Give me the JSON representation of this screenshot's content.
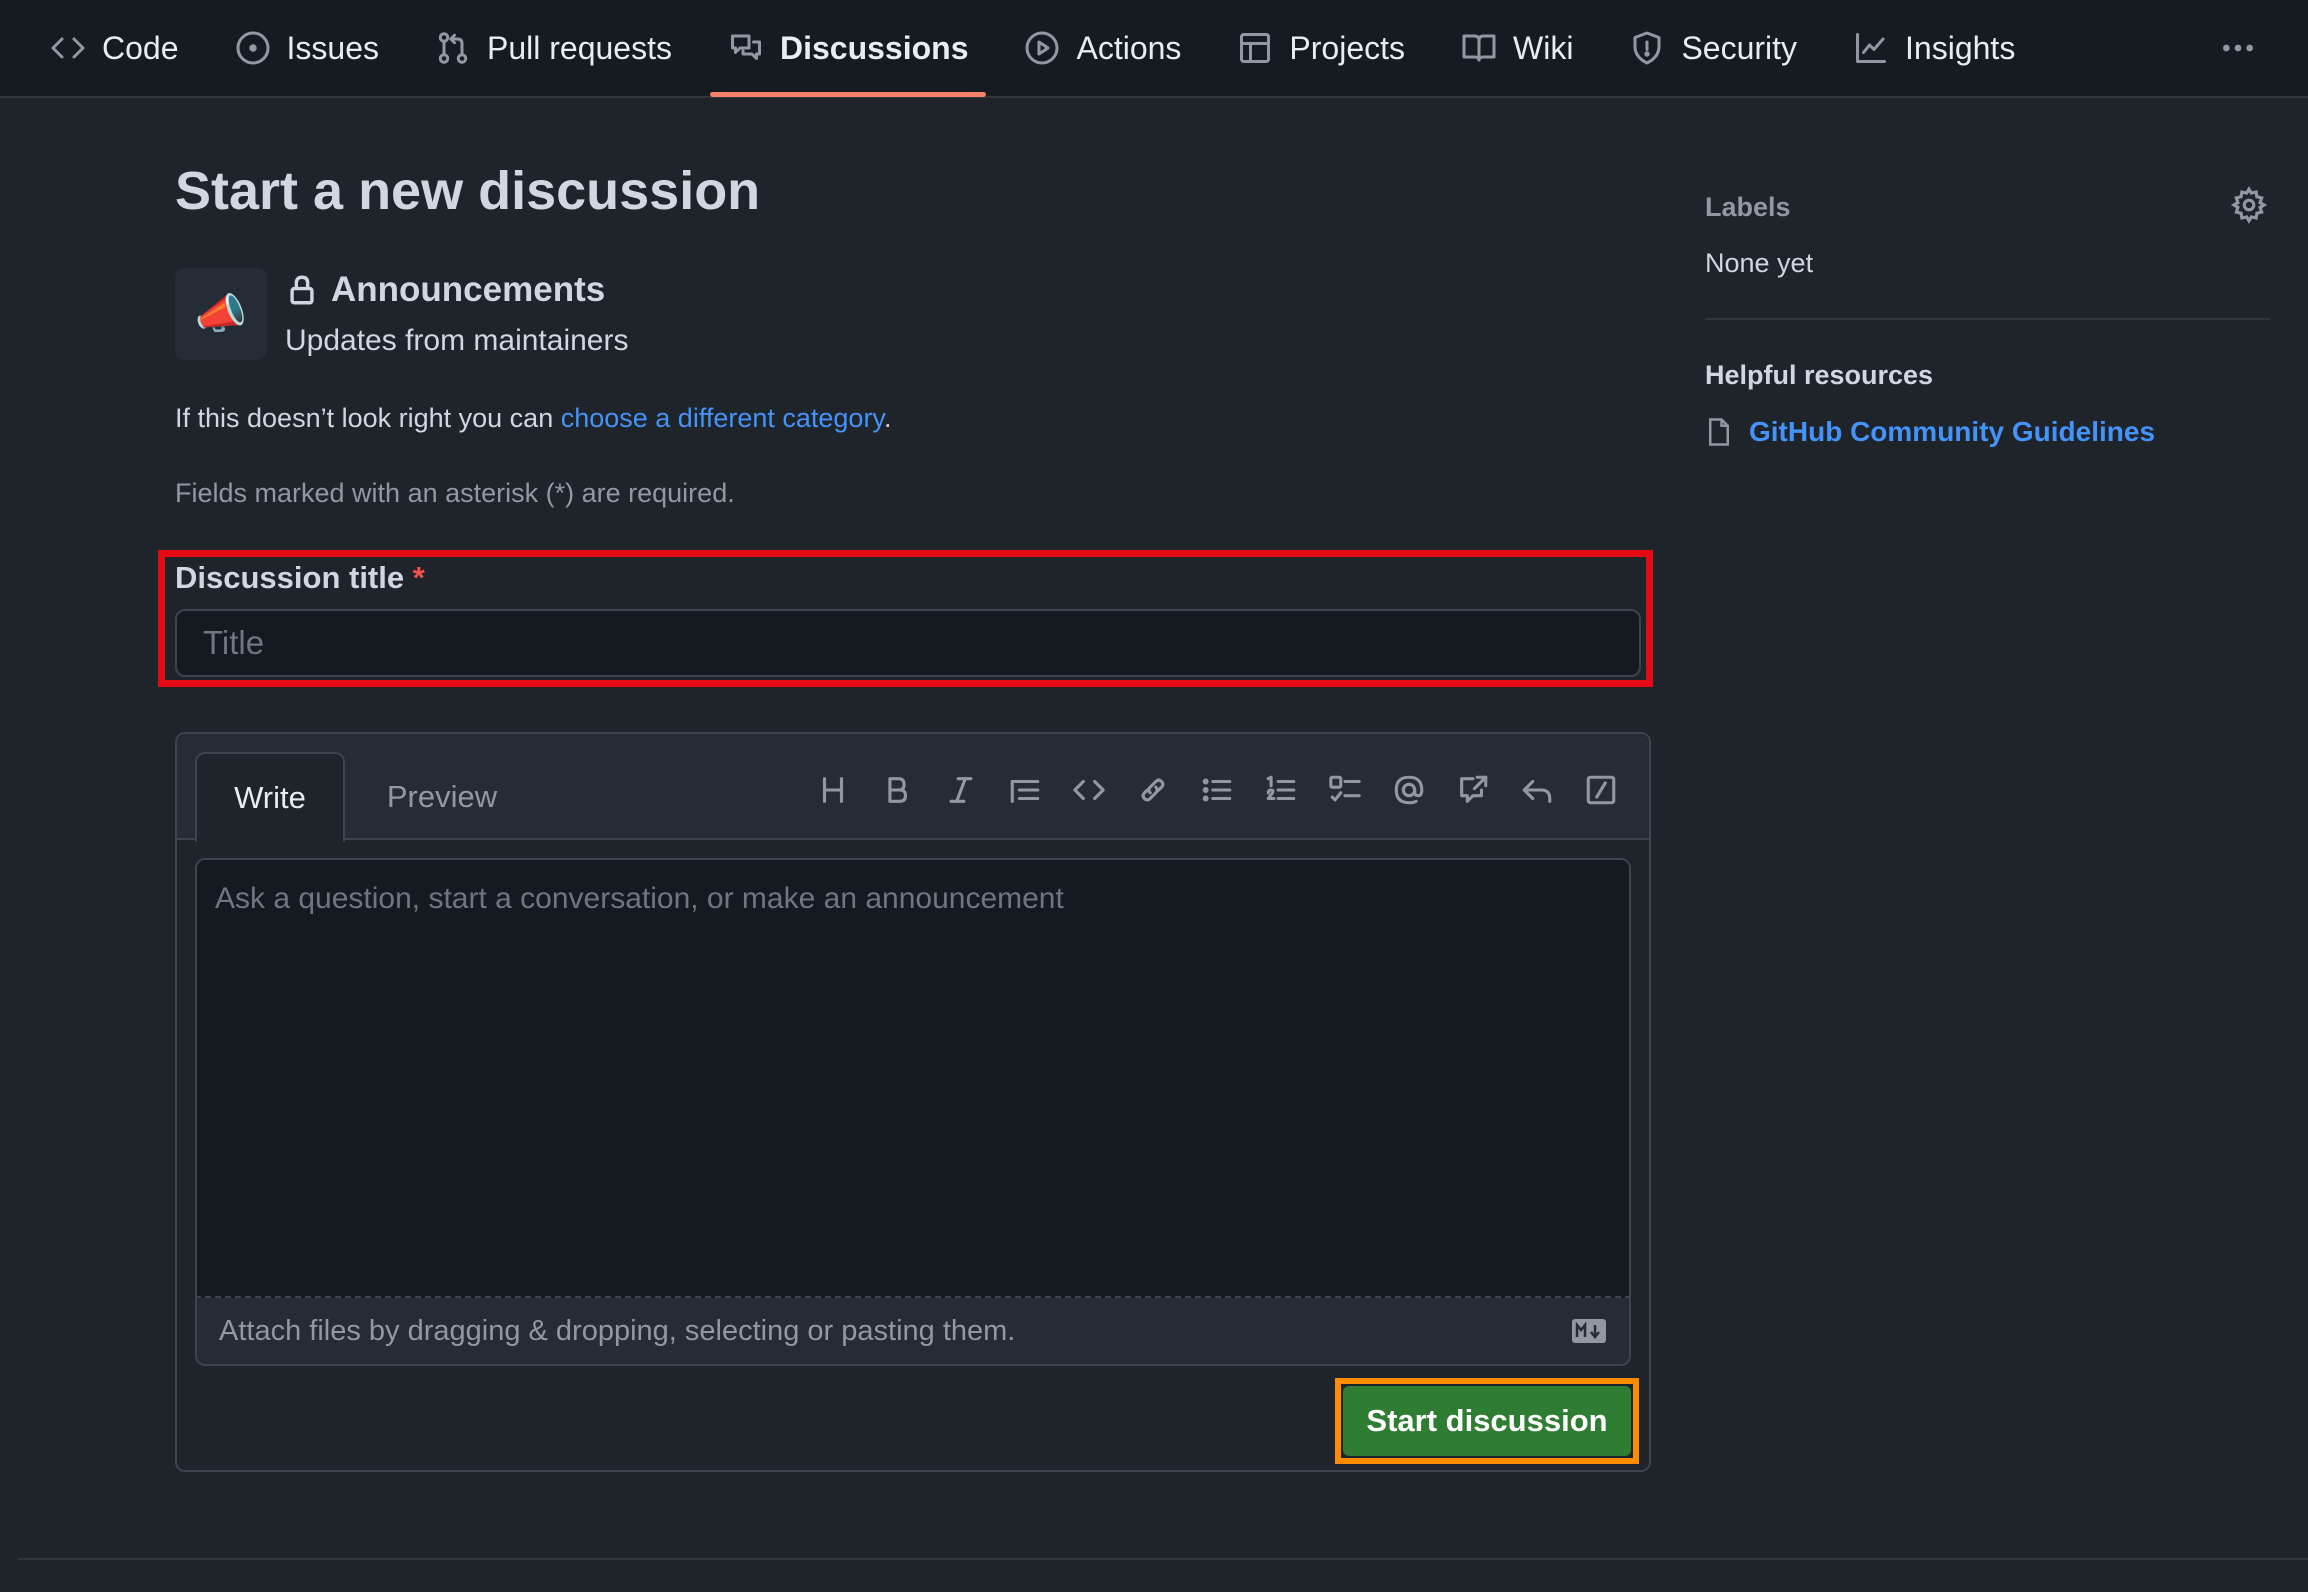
{
  "nav": {
    "items": [
      {
        "label": "Code",
        "icon": "code-icon"
      },
      {
        "label": "Issues",
        "icon": "issue-opened-icon"
      },
      {
        "label": "Pull requests",
        "icon": "git-pull-request-icon"
      },
      {
        "label": "Discussions",
        "icon": "comment-discussion-icon",
        "active": true
      },
      {
        "label": "Actions",
        "icon": "play-icon"
      },
      {
        "label": "Projects",
        "icon": "table-icon"
      },
      {
        "label": "Wiki",
        "icon": "book-icon"
      },
      {
        "label": "Security",
        "icon": "shield-icon"
      },
      {
        "label": "Insights",
        "icon": "graph-icon"
      }
    ],
    "more_icon": "kebab-horizontal-icon"
  },
  "page": {
    "title": "Start a new discussion",
    "category": {
      "emoji": "📣",
      "name": "Announcements",
      "description": "Updates from maintainers",
      "lock_icon": "lock-icon"
    },
    "info_prefix": "If this doesn’t look right you can ",
    "info_link": "choose a different category",
    "info_suffix": ".",
    "required_note": "Fields marked with an asterisk (*) are required."
  },
  "form": {
    "title_label": "Discussion title",
    "required_marker": "*",
    "title_placeholder": "Title",
    "title_value": "",
    "tabs": [
      "Write",
      "Preview"
    ],
    "active_tab": "Write",
    "toolbar": [
      "heading",
      "bold",
      "italic",
      "quote",
      "code",
      "link",
      "bulleted-list",
      "numbered-list",
      "task-list",
      "mention",
      "cross-reference",
      "reply",
      "slash-commands"
    ],
    "body_placeholder": "Ask a question, start a conversation, or make an announcement",
    "attach_text": "Attach files by dragging & dropping, selecting or pasting them.",
    "markdown_icon": "markdown-icon",
    "submit_label": "Start discussion"
  },
  "sidebar": {
    "labels_heading": "Labels",
    "labels_value": "None yet",
    "resources_heading": "Helpful resources",
    "resource_link": "GitHub Community Guidelines"
  },
  "colors": {
    "background": "#1f232a",
    "accent_underline": "#f78166",
    "link": "#4493f8",
    "primary_button": "#2e7d32",
    "highlight_red": "#e50914",
    "highlight_orange": "#ff8c00"
  }
}
